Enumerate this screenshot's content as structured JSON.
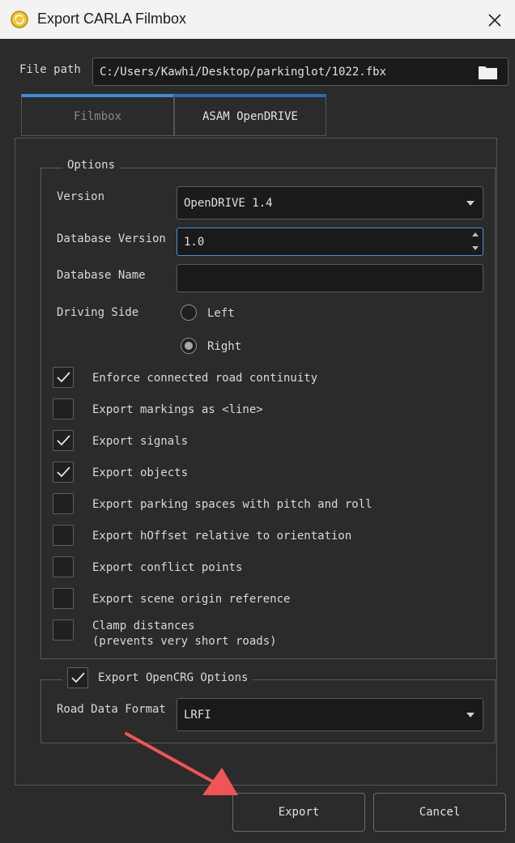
{
  "window": {
    "title": "Export CARLA Filmbox"
  },
  "file_path": {
    "label": "File path",
    "value": "C:/Users/Kawhi/Desktop/parkinglot/1022.fbx"
  },
  "tabs": [
    {
      "label": "Filmbox",
      "active": false
    },
    {
      "label": "ASAM OpenDRIVE",
      "active": true
    }
  ],
  "options": {
    "title": "Options",
    "version": {
      "label": "Version",
      "value": "OpenDRIVE 1.4"
    },
    "database_version": {
      "label": "Database Version",
      "value": "1.0"
    },
    "database_name": {
      "label": "Database Name",
      "value": ""
    },
    "driving_side": {
      "label": "Driving Side",
      "options": [
        "Left",
        "Right"
      ],
      "selected": "Right"
    },
    "checkboxes": [
      {
        "label": "Enforce connected road continuity",
        "checked": true
      },
      {
        "label": "Export markings as <line>",
        "checked": false
      },
      {
        "label": "Export signals",
        "checked": true
      },
      {
        "label": "Export objects",
        "checked": true
      },
      {
        "label": "Export parking spaces with pitch and roll",
        "checked": false
      },
      {
        "label": "Export hOffset relative to orientation",
        "checked": false
      },
      {
        "label": "Export conflict points",
        "checked": false
      },
      {
        "label": "Export scene origin reference",
        "checked": false
      },
      {
        "label": "Clamp distances",
        "label2": "(prevents very short roads)",
        "checked": false
      }
    ]
  },
  "opencrg": {
    "title": "Export OpenCRG Options",
    "checked": true,
    "road_data_format": {
      "label": "Road Data Format",
      "value": "LRFI"
    }
  },
  "buttons": {
    "export": "Export",
    "cancel": "Cancel"
  },
  "colors": {
    "accent": "#3d8bd6",
    "annotation_arrow": "#f05454"
  }
}
